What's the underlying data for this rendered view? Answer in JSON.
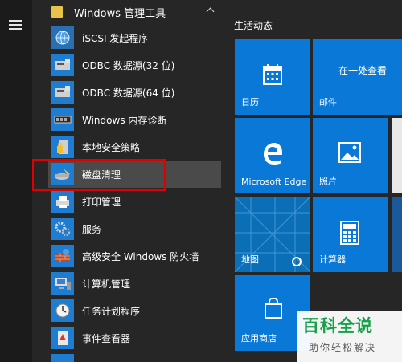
{
  "group": {
    "label": "Windows 管理工具"
  },
  "apps": [
    {
      "label": "iSCSI 发起程序",
      "icon": "globe-icon"
    },
    {
      "label": "ODBC 数据源(32 位)",
      "icon": "database-icon"
    },
    {
      "label": "ODBC 数据源(64 位)",
      "icon": "database-icon"
    },
    {
      "label": "Windows 内存诊断",
      "icon": "memory-chip-icon"
    },
    {
      "label": "本地安全策略",
      "icon": "security-policy-icon"
    },
    {
      "label": "磁盘清理",
      "icon": "disk-cleanup-icon"
    },
    {
      "label": "打印管理",
      "icon": "printer-icon"
    },
    {
      "label": "服务",
      "icon": "gears-icon"
    },
    {
      "label": "高级安全 Windows 防火墙",
      "icon": "firewall-icon"
    },
    {
      "label": "计算机管理",
      "icon": "computer-management-icon"
    },
    {
      "label": "任务计划程序",
      "icon": "clock-icon"
    },
    {
      "label": "事件查看器",
      "icon": "event-viewer-icon"
    }
  ],
  "tiles_section": {
    "title": "生活动态"
  },
  "tiles": {
    "calendar": {
      "label": "日历"
    },
    "mail": {
      "label": "邮件",
      "text": "在一处查看"
    },
    "edge": {
      "label": "Microsoft Edge"
    },
    "photos": {
      "label": "照片"
    },
    "maps": {
      "label": "地图"
    },
    "calculator": {
      "label": "计算器"
    },
    "store": {
      "label": "应用商店"
    }
  },
  "watermark": {
    "main": "百科全说",
    "sub": "助你轻松解决"
  },
  "colors": {
    "tile_blue": "#0a78d7",
    "highlight_red": "#e00000",
    "watermark_green": "#15a04a"
  }
}
